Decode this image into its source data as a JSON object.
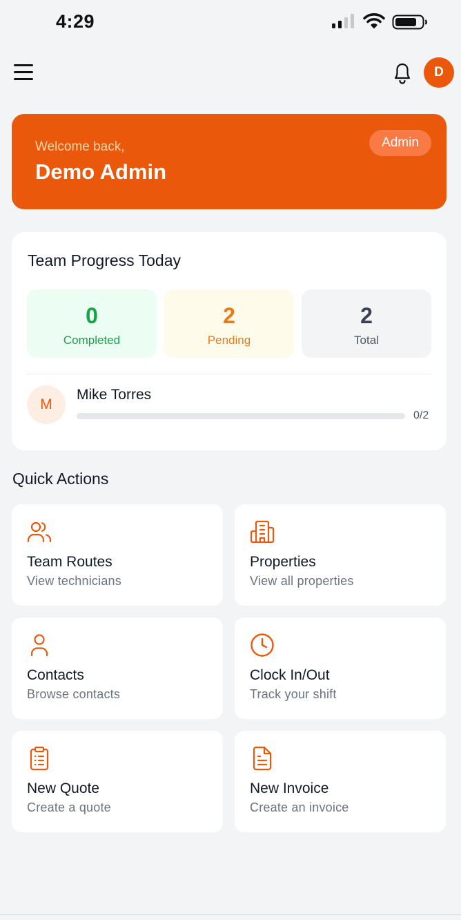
{
  "status_bar": {
    "time": "4:29"
  },
  "header": {
    "avatar_initial": "D"
  },
  "welcome": {
    "greeting": "Welcome back,",
    "name": "Demo Admin",
    "role": "Admin"
  },
  "team_progress": {
    "title": "Team Progress Today",
    "completed": {
      "value": "0",
      "label": "Completed"
    },
    "pending": {
      "value": "2",
      "label": "Pending"
    },
    "total": {
      "value": "2",
      "label": "Total"
    },
    "members": [
      {
        "initial": "M",
        "name": "Mike Torres",
        "count": "0/2",
        "progress": 0
      }
    ]
  },
  "quick_actions": {
    "title": "Quick Actions",
    "items": [
      {
        "title": "Team Routes",
        "subtitle": "View technicians",
        "icon": "users-icon"
      },
      {
        "title": "Properties",
        "subtitle": "View all properties",
        "icon": "building-icon"
      },
      {
        "title": "Contacts",
        "subtitle": "Browse contacts",
        "icon": "user-icon"
      },
      {
        "title": "Clock In/Out",
        "subtitle": "Track your shift",
        "icon": "clock-icon"
      },
      {
        "title": "New Quote",
        "subtitle": "Create a quote",
        "icon": "clipboard-list-icon"
      },
      {
        "title": "New Invoice",
        "subtitle": "Create an invoice",
        "icon": "file-text-icon"
      }
    ]
  },
  "colors": {
    "accent": "#ea580c",
    "completed": "#16a34a",
    "pending": "#ea7a1a",
    "background": "#f3f4f6"
  }
}
